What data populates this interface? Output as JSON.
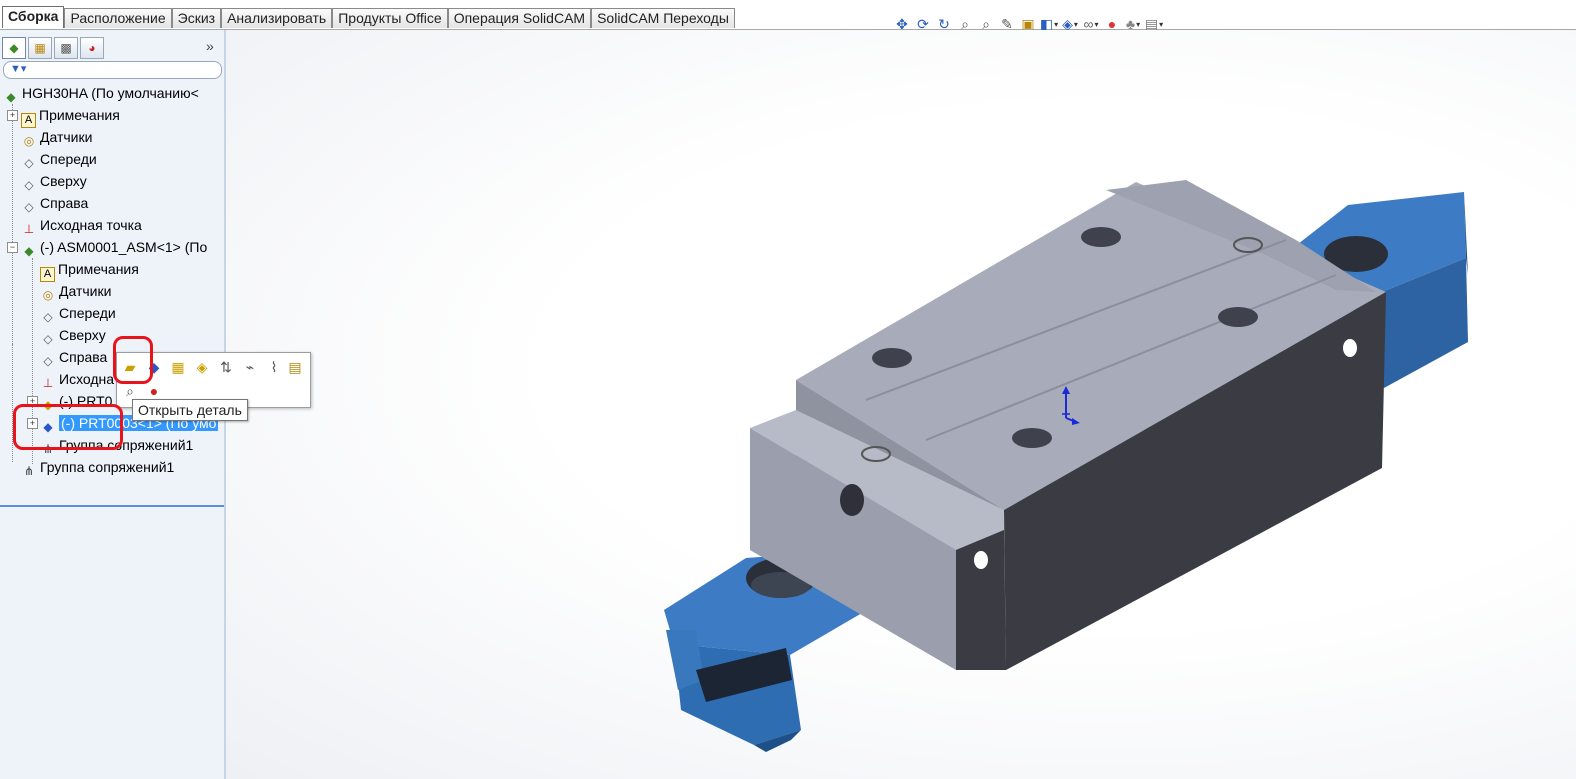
{
  "tabs": [
    {
      "label": "Сборка",
      "active": true
    },
    {
      "label": "Расположение",
      "active": false
    },
    {
      "label": "Эскиз",
      "active": false
    },
    {
      "label": "Анализировать",
      "active": false
    },
    {
      "label": "Продукты Office",
      "active": false
    },
    {
      "label": "Операция  SolidCAM",
      "active": false
    },
    {
      "label": "SolidCAM Переходы",
      "active": false
    }
  ],
  "hud_icons": [
    "zoom-to-fit-icon",
    "rotate-icon",
    "redo-rotate-icon",
    "zoom-area-icon",
    "zoom-in-out-icon",
    "section-view-icon",
    "view-orientation-icon",
    "display-style-icon",
    "hide-show-items-icon",
    "edit-appearance-icon",
    "apply-scene-icon",
    "view-settings-icon"
  ],
  "panel": {
    "tabs": [
      "feature-manager-icon",
      "property-manager-icon",
      "configuration-manager-icon",
      "display-manager-icon"
    ],
    "expand_symbol": "»",
    "filter_icon": "filter-icon"
  },
  "tree": {
    "root": "HGH30HA  (По умолчанию<",
    "items": [
      {
        "label": "Примечания",
        "icon": "annotations-icon"
      },
      {
        "label": "Датчики",
        "icon": "sensors-icon"
      },
      {
        "label": "Спереди",
        "icon": "plane-icon"
      },
      {
        "label": "Сверху",
        "icon": "plane-icon"
      },
      {
        "label": "Справа",
        "icon": "plane-icon"
      },
      {
        "label": "Исходная точка",
        "icon": "origin-icon"
      },
      {
        "label": "(-) ASM0001_ASM<1> (По",
        "icon": "assembly-icon"
      },
      {
        "label": "Примечания",
        "icon": "annotations-icon"
      },
      {
        "label": "Датчики",
        "icon": "sensors-icon"
      },
      {
        "label": "Спереди",
        "icon": "plane-icon"
      },
      {
        "label": "Сверху",
        "icon": "plane-icon"
      },
      {
        "label": "Справа",
        "icon": "plane-icon"
      },
      {
        "label": "Исходна",
        "icon": "origin-icon"
      },
      {
        "label": "(-) PRT0",
        "icon": "part-icon"
      },
      {
        "label": "(-) PRT0003<1> (По умо",
        "icon": "part-icon"
      },
      {
        "label": "Группа сопряжений1",
        "icon": "mates-icon"
      },
      {
        "label": "Группа сопряжений1",
        "icon": "mates-icon"
      }
    ]
  },
  "context_toolbar": {
    "buttons": [
      "open-part-icon",
      "edit-part-icon",
      "isolate-icon",
      "change-transparency-icon",
      "sort-icon",
      "mate-icon",
      "smart-mate-icon",
      "properties-icon",
      "zoom-selection-icon",
      "appearance-icon"
    ],
    "tooltip": "Открыть деталь"
  },
  "colors": {
    "rail": "#3d7cc4",
    "block_top": "#a6aab8",
    "block_side": "#3b3c44",
    "selection": "#3399ff",
    "highlight": "#e8141c"
  }
}
